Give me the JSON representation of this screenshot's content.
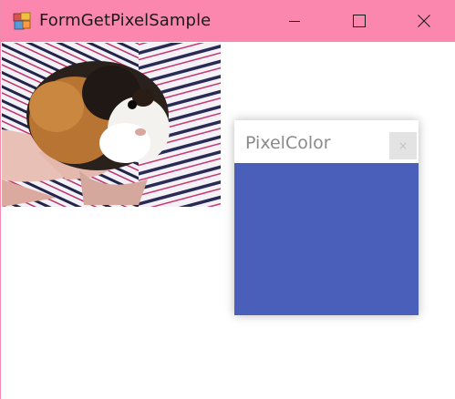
{
  "window": {
    "title": "FormGetPixelSample",
    "titlebar_color": "#fb87ae",
    "controls": {
      "minimize_icon": "minimize-icon",
      "maximize_icon": "maximize-icon",
      "close_icon": "close-icon"
    }
  },
  "photo": {
    "subject": "guinea pig held by person in striped shirt"
  },
  "pixel_popup": {
    "title": "PixelColor",
    "close_glyph": "×",
    "color": "#4a5fba"
  }
}
